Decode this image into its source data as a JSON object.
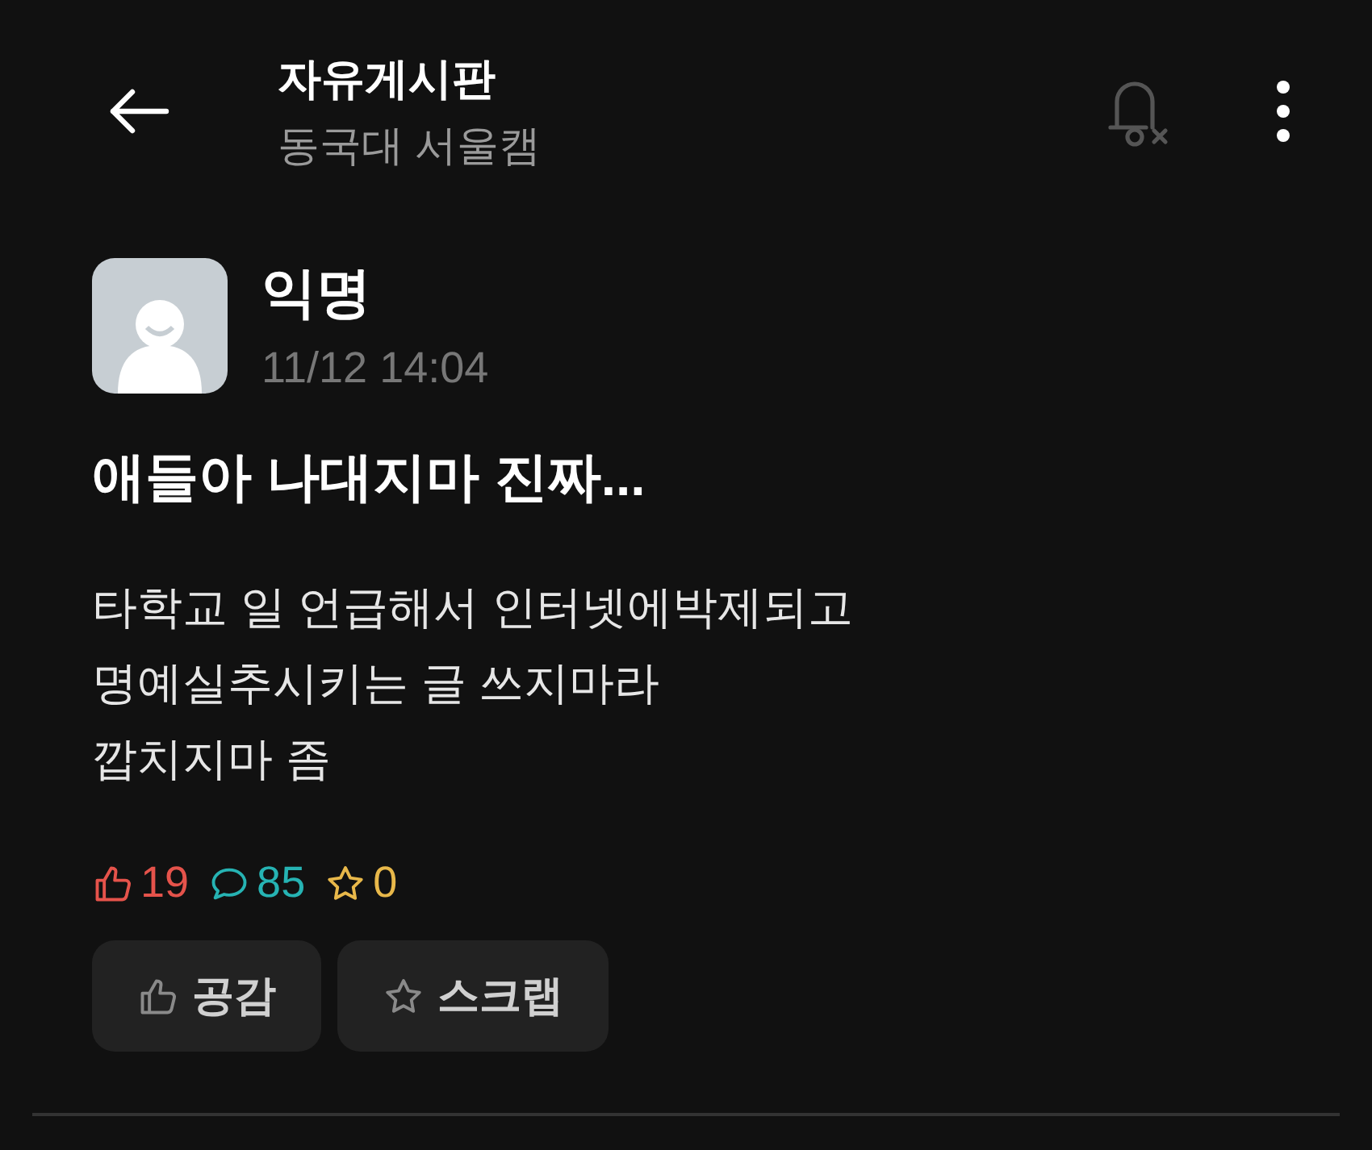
{
  "header": {
    "title": "자유게시판",
    "subtitle": "동국대 서울캠"
  },
  "post": {
    "author": "익명",
    "time": "11/12 14:04",
    "title": "애들아 나대지마 진짜...",
    "body": [
      "타학교 일 언급해서 인터넷에박제되고",
      "명예실추시키는 글 쓰지마라",
      "깝치지마 좀"
    ]
  },
  "stats": [
    {
      "kind": "like",
      "count": "19",
      "color": "#e5534b"
    },
    {
      "kind": "comment",
      "count": "85",
      "color": "#26b3b3"
    },
    {
      "kind": "scrap",
      "count": "0",
      "color": "#e8b84a"
    }
  ],
  "buttons": [
    {
      "kind": "like",
      "label": "공감"
    },
    {
      "kind": "scrap",
      "label": "스크랩"
    }
  ]
}
